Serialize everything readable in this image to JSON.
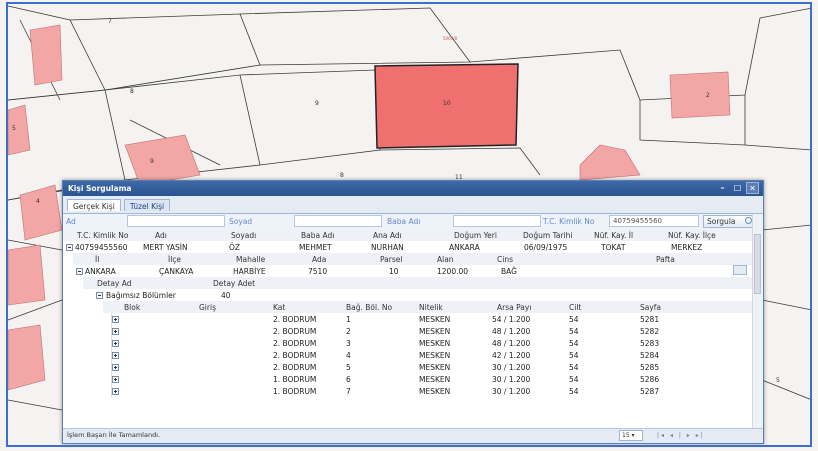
{
  "map": {
    "parcels": [
      "7",
      "8",
      "9",
      "10",
      "2",
      "5",
      "4",
      "9",
      "8",
      "11",
      "5"
    ],
    "top_label": "5003/8"
  },
  "dialog": {
    "title": "Kişi Sorgulama",
    "tabs": [
      "Gerçek Kişi",
      "Tüzel Kişi"
    ],
    "search": {
      "ad_label": "Ad",
      "soyad_label": "Soyad",
      "baba_adi_label": "Baba Adı",
      "tc_label": "T.C. Kimlik No",
      "tc_value": "40759455560",
      "button": "Sorgula"
    },
    "person_header": [
      "T.C. Kimlik No",
      "Adı",
      "Soyadı",
      "Baba Adı",
      "Ana Adı",
      "Doğum Yeri",
      "Doğum Tarihi",
      "Nüf. Kay. İl",
      "Nüf. Kay. İlçe"
    ],
    "person": [
      "40759455560",
      "MERT YASİN",
      "ÖZ",
      "MEHMET",
      "NURHAN",
      "ANKARA",
      "06/09/1975",
      "TOKAT",
      "MERKEZ"
    ],
    "parcel_header": [
      "İl",
      "İlçe",
      "Mahalle",
      "Ada",
      "Parsel",
      "Alan",
      "Cins",
      "Pafta"
    ],
    "parcel": [
      "ANKARA",
      "ÇANKAYA",
      "HARBİYE",
      "7510",
      "10",
      "1200.00",
      "BAĞ",
      ""
    ],
    "detay_header": [
      "Detay Ad",
      "Detay Adet"
    ],
    "detay": [
      "Bağımsız Bölümler",
      "40"
    ],
    "unit_header": [
      "Blok",
      "Giriş",
      "Kat",
      "Bağ. Böl. No",
      "Nitelik",
      "Arsa Payı",
      "Cilt",
      "Sayfa"
    ],
    "units": [
      [
        "2. BODRUM",
        "1",
        "MESKEN",
        "54 / 1.200",
        "54",
        "5281"
      ],
      [
        "2. BODRUM",
        "2",
        "MESKEN",
        "48 / 1.200",
        "54",
        "5282"
      ],
      [
        "2. BODRUM",
        "3",
        "MESKEN",
        "48 / 1.200",
        "54",
        "5283"
      ],
      [
        "2. BODRUM",
        "4",
        "MESKEN",
        "42 / 1.200",
        "54",
        "5284"
      ],
      [
        "2. BODRUM",
        "5",
        "MESKEN",
        "30 / 1.200",
        "54",
        "5285"
      ],
      [
        "1. BODRUM",
        "6",
        "MESKEN",
        "30 / 1.200",
        "54",
        "5286"
      ],
      [
        "1. BODRUM",
        "7",
        "MESKEN",
        "30 / 1.200",
        "54",
        "5287"
      ]
    ],
    "status": "İşlem Başarı İle Tamamlandı.",
    "page_size": "15"
  }
}
